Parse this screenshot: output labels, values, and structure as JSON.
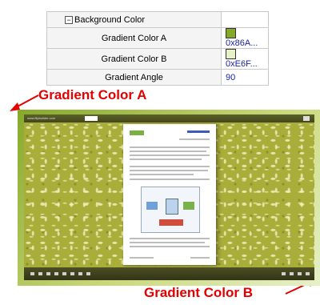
{
  "property_grid": {
    "group_label": "Background Color",
    "rows": [
      {
        "name": "Gradient Color A",
        "value": "0x86A...",
        "swatch": "#86a92a"
      },
      {
        "name": "Gradient Color B",
        "value": "0xE6F...",
        "swatch": "#e6f1c8"
      },
      {
        "name": "Gradient Angle",
        "value": "90"
      }
    ]
  },
  "annotations": {
    "label_a": "Gradient Color A",
    "label_b": "Gradient Color B",
    "color": "#e30000"
  },
  "preview": {
    "site": "www.flipbuilder.com"
  }
}
